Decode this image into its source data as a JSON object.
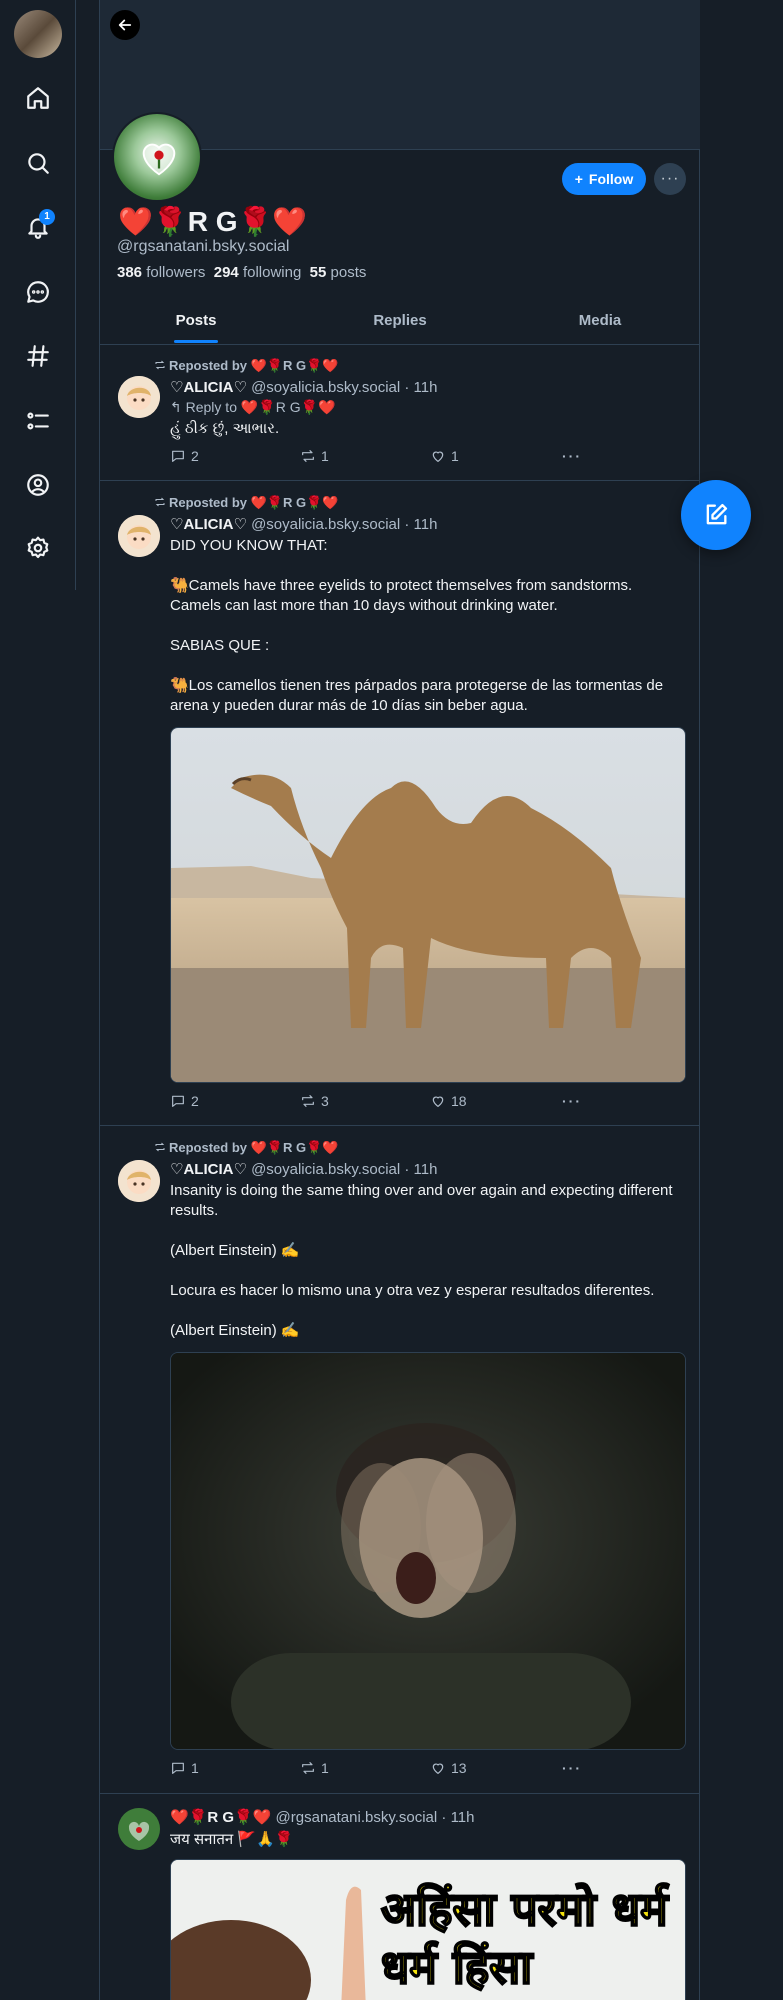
{
  "nav": {
    "notification_count": "1",
    "items": [
      "home-icon",
      "search-icon",
      "bell-icon",
      "chat-icon",
      "hashtag-icon",
      "list-icon",
      "profile-icon",
      "settings-icon"
    ]
  },
  "profile": {
    "display_name": "❤️🌹R G🌹❤️",
    "handle": "@rgsanatani.bsky.social",
    "followers_count": "386",
    "followers_label": "followers",
    "following_count": "294",
    "following_label": "following",
    "posts_count": "55",
    "posts_label": "posts",
    "follow_label": "Follow",
    "more_label": "···"
  },
  "tabs": [
    {
      "label": "Posts",
      "active": true
    },
    {
      "label": "Replies",
      "active": false
    },
    {
      "label": "Media",
      "active": false
    }
  ],
  "posts": [
    {
      "repost_label": "Reposted by ❤️🌹R G🌹❤️",
      "name": "♡ALICIA♡",
      "meta": "@soyalicia.bsky.social · 11h",
      "reply_to": "↰ Reply to ❤️🌹R G🌹❤️",
      "text": "હું ઠીક છું, આભાર.",
      "replies": "2",
      "reposts": "1",
      "likes": "1"
    },
    {
      "repost_label": "Reposted by ❤️🌹R G🌹❤️",
      "name": "♡ALICIA♡",
      "meta": "@soyalicia.bsky.social · 11h",
      "text": "DID YOU KNOW THAT:\n\n🐫Camels have three eyelids to protect themselves from sandstorms. Camels can last more than 10 days without drinking water.\n\nSABIAS QUE :\n\n🐫Los camellos tienen tres párpados para protegerse de las tormentas de arena y pueden durar más de 10 días sin beber agua.",
      "replies": "2",
      "reposts": "3",
      "likes": "18"
    },
    {
      "repost_label": "Reposted by ❤️🌹R G🌹❤️",
      "name": "♡ALICIA♡",
      "meta": "@soyalicia.bsky.social · 11h",
      "text": "Insanity is doing the same thing over and over again and expecting different results.\n\n(Albert Einstein) ✍️\n\nLocura es hacer lo mismo una y otra vez y esperar resultados diferentes.\n\n(Albert Einstein) ✍️",
      "replies": "1",
      "reposts": "1",
      "likes": "13"
    },
    {
      "name": "❤️🌹R G🌹❤️",
      "meta": "@rgsanatani.bsky.social · 11h",
      "text": "जय सनातन 🚩🙏🌹",
      "image_text": "अहिंसा परमो धर्म धर्म हिंसा"
    }
  ],
  "colors": {
    "background": "#161e27",
    "accent": "#1083fe",
    "border": "#2e4052",
    "muted_text": "#aebbc9"
  }
}
